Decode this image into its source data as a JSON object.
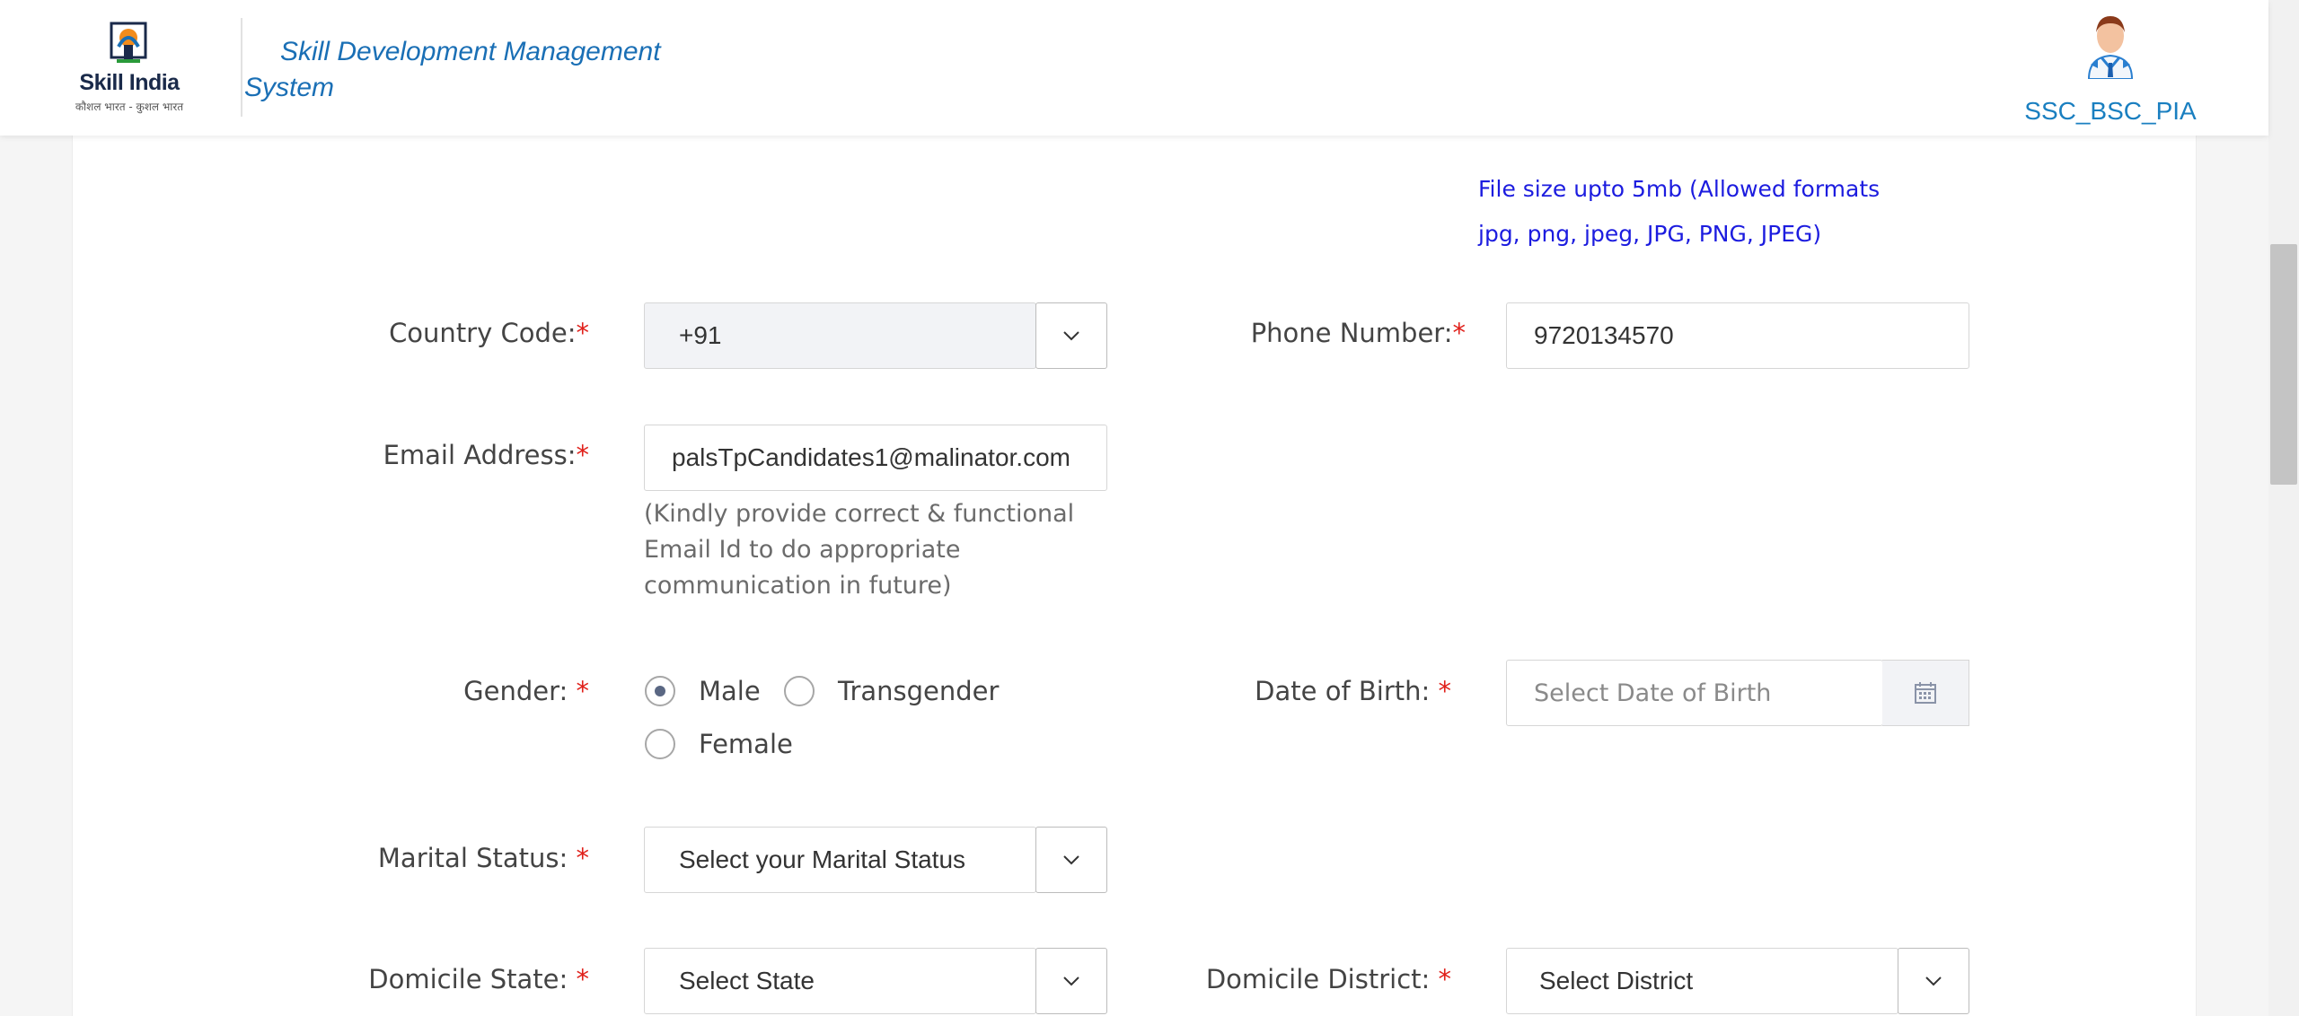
{
  "header": {
    "logo_text": "Skill India",
    "logo_subtext": "कौशल भारत - कुशल भारत",
    "app_title": "Skill Development Management System",
    "username": "SSC_BSC_PIA"
  },
  "form": {
    "file_note": "File size upto 5mb (Allowed formats jpg, png, jpeg, JPG, PNG, JPEG)",
    "country_code": {
      "label": "Country Code:",
      "required": "*",
      "value": "+91"
    },
    "phone": {
      "label": "Phone Number:",
      "required": "*",
      "value": "9720134570"
    },
    "email": {
      "label": "Email Address:",
      "required": "*",
      "value": "palsTpCandidates1@malinator.com",
      "hint": "(Kindly provide correct & functional Email Id to do appropriate communication in future)"
    },
    "gender": {
      "label": "Gender: ",
      "required": "*",
      "options": [
        "Male",
        "Transgender",
        "Female"
      ],
      "selected": "Male"
    },
    "dob": {
      "label": "Date of Birth: ",
      "required": "*",
      "placeholder": "Select Date of Birth"
    },
    "marital_status": {
      "label": "Marital Status: ",
      "required": "*",
      "value": "Select your Marital Status"
    },
    "domicile_state": {
      "label": "Domicile State: ",
      "required": "*",
      "value": "Select State"
    },
    "domicile_district": {
      "label": "Domicile District: ",
      "required": "*",
      "value": "Select District"
    }
  },
  "colors": {
    "title": "#1a6fb5",
    "required": "#e0201a",
    "note": "#1c1cdf",
    "username": "#1a7fc0"
  },
  "icons": {
    "logo": "skill-india-logo",
    "avatar": "user-avatar-icon",
    "dropdown": "chevron-down-icon",
    "calendar": "calendar-icon"
  }
}
